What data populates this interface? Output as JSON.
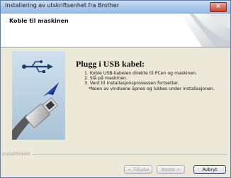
{
  "window": {
    "title": "Installering av utskriftsenhet fra Brother",
    "close_symbol": "×"
  },
  "header": {
    "title": "Koble til maskinen"
  },
  "main": {
    "heading": "Plugg i USB kabel:",
    "steps": [
      "1. Koble USB-kabelen direkte til PCen og maskinen.",
      "2. Slå på maskinen.",
      "3. Vent til installasjonsprosessen fortsetter.",
      "   *Noen av vinduene åpnes og lukkes under installasjonen."
    ]
  },
  "footer": {
    "brand": "InstallShield",
    "back_label": "< Tilbake",
    "next_label": "Neste >",
    "cancel_label": "Avbryt"
  },
  "icons": {
    "usb": "usb-icon",
    "close": "close-icon"
  }
}
